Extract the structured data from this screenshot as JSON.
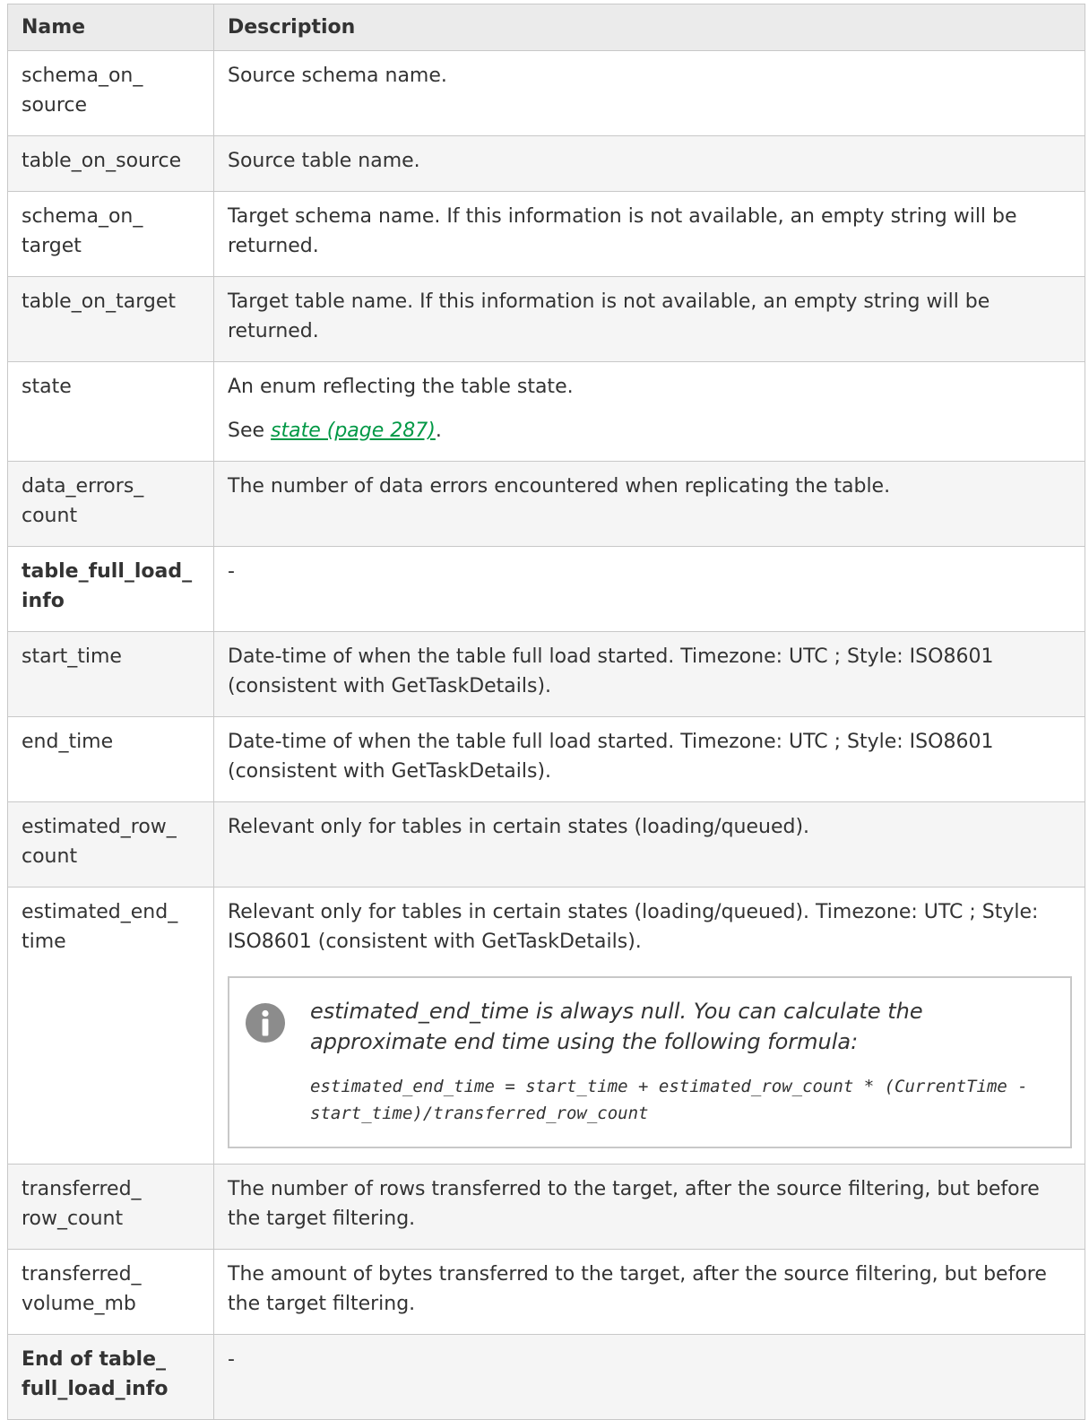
{
  "table": {
    "headers": {
      "name": "Name",
      "description": "Description"
    },
    "rows": [
      {
        "name": "schema_on_\nsource",
        "desc": [
          "Source schema name."
        ]
      },
      {
        "name": "table_on_source",
        "desc": [
          "Source table name."
        ]
      },
      {
        "name": "schema_on_\ntarget",
        "desc": [
          "Target schema name. If this information is not available, an empty string will be returned."
        ]
      },
      {
        "name": "table_on_target",
        "desc": [
          "Target table name. If this information is not available, an empty string will be returned."
        ]
      },
      {
        "name": "state",
        "desc": [
          "An enum reflecting the table state."
        ],
        "see": {
          "prefix": "See ",
          "link": "state (page 287)",
          "suffix": "."
        }
      },
      {
        "name": "data_errors_\ncount",
        "desc": [
          "The number of data errors encountered when replicating the table."
        ]
      },
      {
        "name": "table_full_load_\ninfo",
        "bold": true,
        "desc": [
          "-"
        ]
      },
      {
        "name": "start_time",
        "desc": [
          "Date-time of when the table full load started. Timezone: UTC ; Style: ISO8601 (consistent with GetTaskDetails)."
        ]
      },
      {
        "name": "end_time",
        "desc": [
          "Date-time of when the table full load started. Timezone: UTC ; Style: ISO8601 (consistent with GetTaskDetails)."
        ]
      },
      {
        "name": "estimated_row_\ncount",
        "desc": [
          "Relevant only for tables in certain states (loading/queued)."
        ]
      },
      {
        "name": "estimated_end_\ntime",
        "desc": [
          "Relevant only for tables in certain states (loading/queued). Timezone: UTC ; Style: ISO8601 (consistent with GetTaskDetails)."
        ],
        "note": {
          "icon": "info-icon",
          "text": "estimated_end_time is always null. You can calculate the approximate end time using the following formula:",
          "formula": "estimated_end_time = start_time + estimated_row_count * (CurrentTime - start_time)/transferred_row_count"
        }
      },
      {
        "name": "transferred_\nrow_count",
        "desc": [
          "The number of rows transferred to the target, after the source filtering, but before the target filtering."
        ]
      },
      {
        "name": "transferred_\nvolume_mb",
        "desc": [
          "The amount of bytes transferred to the target, after the source filtering, but before the target filtering."
        ]
      },
      {
        "name": "End of table_\nfull_load_info",
        "bold": true,
        "desc": [
          "-"
        ]
      }
    ]
  },
  "colors": {
    "link": "#009845",
    "border": "#c8c8c8",
    "header_bg": "#ebebeb",
    "alt_row_bg": "#f5f5f5",
    "icon": "#8c8c8c"
  }
}
